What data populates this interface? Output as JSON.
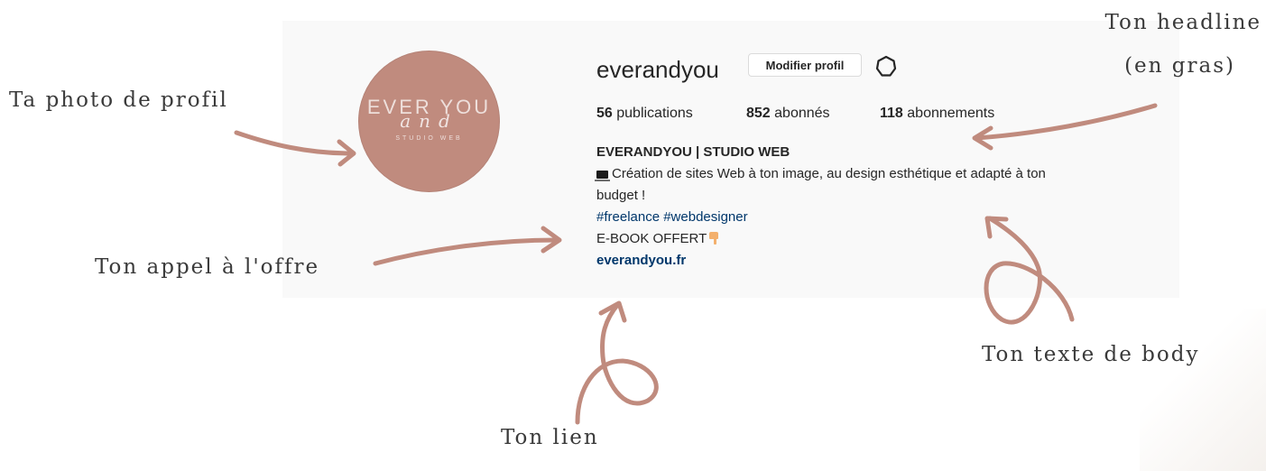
{
  "profile": {
    "avatar_text_line1": "EVER YOU",
    "avatar_text_script": "and",
    "avatar_text_sub": "STUDIO WEB",
    "username": "everandyou",
    "edit_button_label": "Modifier profil",
    "stats": {
      "publications_count": "56",
      "publications_label": "publications",
      "followers_count": "852",
      "followers_label": "abonnés",
      "following_count": "118",
      "following_label": "abonnements"
    },
    "bio": {
      "name": "EVERANDYOU | STUDIO WEB",
      "line1": "Création de sites Web à ton image, au design esthétique et adapté à ton",
      "line2": "budget !",
      "hashtags": "#freelance #webdesigner",
      "offer": "E-BOOK OFFERT",
      "link": "everandyou.fr"
    }
  },
  "annotations": {
    "photo": "Ta photo de profil",
    "headline_line1": "Ton headline",
    "headline_line2": "(en gras)",
    "offer_call": "Ton appel à l'offre",
    "body_text": "Ton texte de body",
    "link": "Ton lien"
  },
  "colors": {
    "arrow": "#c08b7e",
    "avatar": "#c08b7e",
    "link_blue": "#00376b",
    "panel_bg": "#f9f9f9"
  },
  "icons": {
    "settings": "gear-icon",
    "bio_emoji_1": "laptop-icon",
    "bio_emoji_2": "pointing-down-hand-icon"
  }
}
